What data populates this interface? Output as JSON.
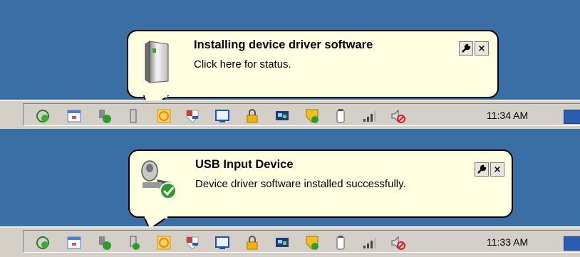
{
  "balloons": [
    {
      "title": "Installing device driver software",
      "message": "Click here for status.",
      "icon": "hard-drive-icon",
      "close_glyph": "×",
      "time": "11:34 AM"
    },
    {
      "title": "USB Input Device",
      "message": "Device driver software installed successfully.",
      "icon": "usb-mouse-success-icon",
      "close_glyph": "×",
      "time": "11:33 AM"
    }
  ],
  "tray_icons": [
    "network-icon",
    "app-window-icon",
    "safely-remove-icon",
    "usb-device-icon",
    "orange-clock-icon",
    "shield-flag-icon",
    "monitor-icon",
    "lock-icon",
    "display-settings-icon",
    "security-shield-icon",
    "battery-icon",
    "signal-icon",
    "volume-muted-icon"
  ],
  "colors": {
    "desktop": "#3a6ea5",
    "balloon": "#ffffe1",
    "taskbar": "#d4d0c8"
  }
}
